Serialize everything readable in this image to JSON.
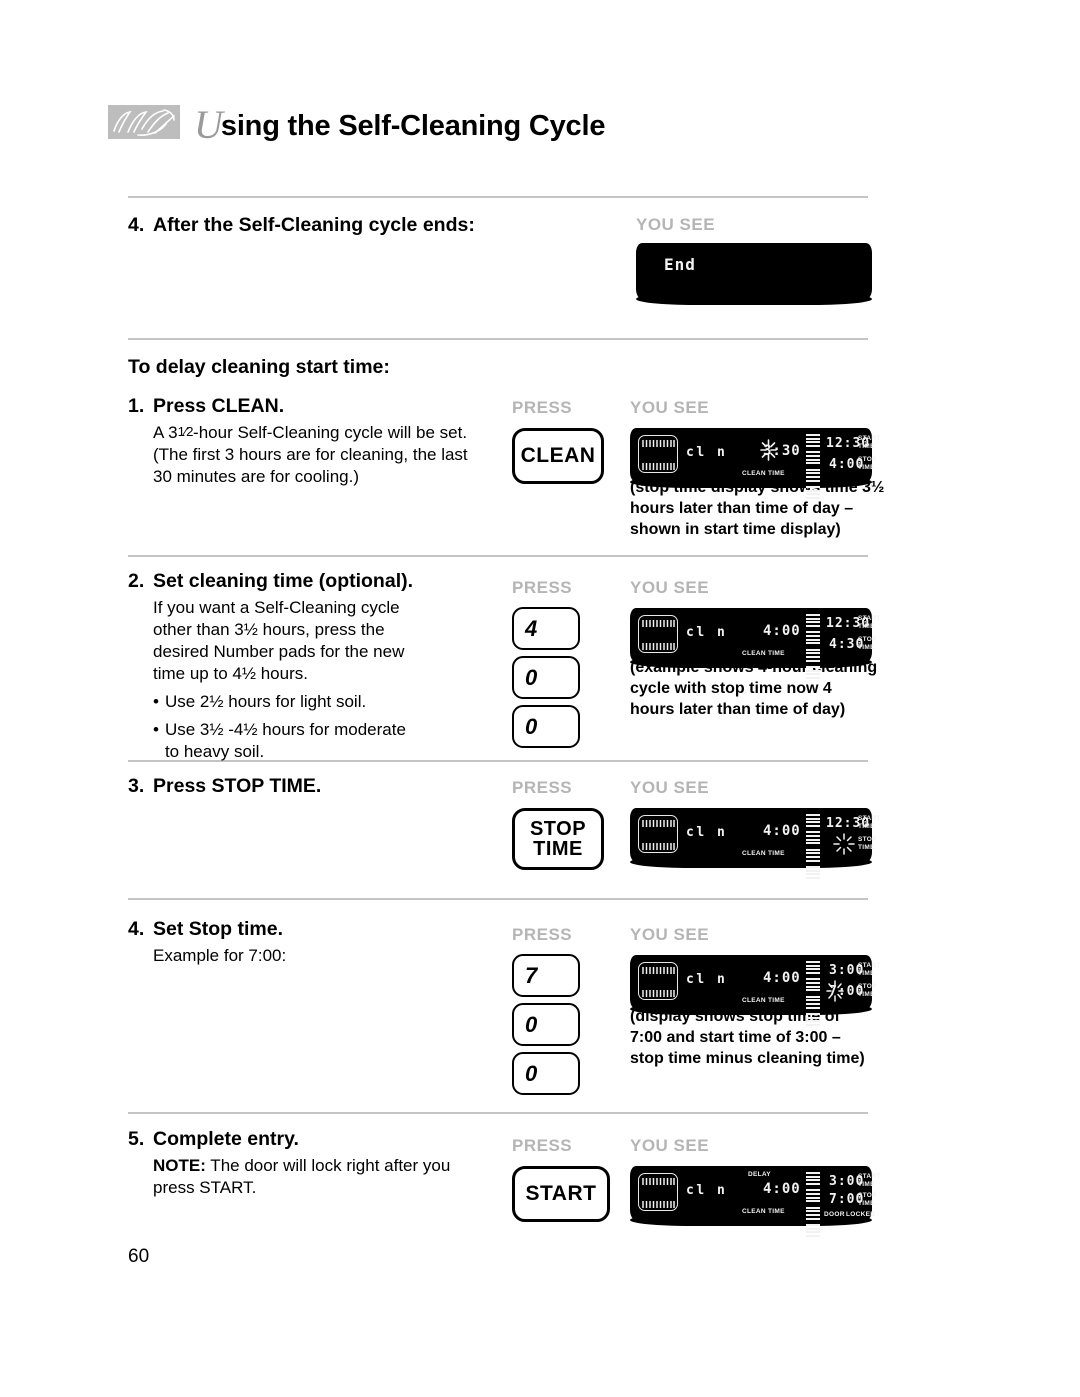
{
  "header": {
    "script_letter": "U",
    "title": "sing the Self-Cleaning Cycle",
    "logo_icon": "signature-swirl-logo"
  },
  "columns": {
    "press": "PRESS",
    "you_see": "YOU SEE"
  },
  "page_number": "60",
  "sections": {
    "step4_end": {
      "number": "4.",
      "heading": "After the Self-Cleaning cycle ends:",
      "display": {
        "text": "End"
      }
    },
    "delay_intro": {
      "heading": "To delay cleaning start time:"
    },
    "step1": {
      "number": "1.",
      "heading": "Press CLEAN.",
      "body_1": "A 3",
      "body_frac": "1⁄2",
      "body_2": "-hour Self-Cleaning cycle will be set. (The first 3 hours are for cleaning, the last 30 minutes are for cooling.)",
      "button": "CLEAN",
      "display": {
        "oven_icon": "oven-icon",
        "mode": "cl n",
        "clean_time": "3:30",
        "clean_time_blinking": true,
        "clean_time_label": "CLEAN TIME",
        "start_time": "12:30",
        "start_label_1": "START",
        "start_label_2": "TIME",
        "stop_time": "4:00",
        "stop_label_1": "STOP",
        "stop_label_2": "TIME"
      },
      "caption": "(stop time display shows time 3½ hours later than time of day – shown in start time display)"
    },
    "step2": {
      "number": "2.",
      "heading": "Set cleaning time (optional).",
      "body": "If you want a Self-Cleaning cycle other than 3½ hours, press the desired Number pads for the new time up to 4½ hours.",
      "bullet1": "Use 2½ hours for light soil.",
      "bullet2": "Use 3½ -4½ hours for moderate to heavy soil.",
      "keys": [
        "4",
        "0",
        "0"
      ],
      "display": {
        "mode": "cl n",
        "clean_time": "4:00",
        "clean_time_label": "CLEAN TIME",
        "start_time": "12:30",
        "start_label_1": "START",
        "start_label_2": "TIME",
        "stop_time": "4:30",
        "stop_label_1": "STOP",
        "stop_label_2": "TIME"
      },
      "caption": "(example shows 4-hour cleaning cycle with stop time now 4 hours later than time of day)"
    },
    "step3": {
      "number": "3.",
      "heading": "Press STOP TIME.",
      "button_line1": "STOP",
      "button_line2": "TIME",
      "display": {
        "mode": "cl n",
        "clean_time": "4:00",
        "clean_time_label": "CLEAN TIME",
        "start_time": "12:30",
        "start_label_1": "START",
        "start_label_2": "TIME",
        "stop_time": "",
        "stop_time_blinking": true,
        "stop_label_1": "STOP",
        "stop_label_2": "TIME"
      }
    },
    "step4_stop": {
      "number": "4.",
      "heading": "Set Stop time.",
      "body": "Example for 7:00:",
      "keys": [
        "7",
        "0",
        "0"
      ],
      "display": {
        "mode": "cl n",
        "clean_time": "4:00",
        "clean_time_label": "CLEAN TIME",
        "start_time": "3:00",
        "start_label_1": "START",
        "start_label_2": "TIME",
        "stop_time": "7:00",
        "stop_time_blinking": true,
        "stop_label_1": "STOP",
        "stop_label_2": "TIME"
      },
      "caption": "(display shows stop time of 7:00 and start time of 3:00 – stop time minus cleaning time)"
    },
    "step5": {
      "number": "5.",
      "heading": "Complete entry.",
      "note_label": "NOTE:",
      "note_body": " The door will lock right after you press START.",
      "button": "START",
      "display": {
        "delay_label": "DELAY",
        "mode": "cl n",
        "clean_time": "4:00",
        "clean_time_label": "CLEAN TIME",
        "door_label": "DOOR",
        "locked_label": "LOCKED",
        "start_time": "3:00",
        "start_label_1": "START",
        "start_label_2": "TIME",
        "stop_time": "7:00",
        "stop_label_1": "STOP",
        "stop_label_2": "TIME"
      }
    }
  }
}
